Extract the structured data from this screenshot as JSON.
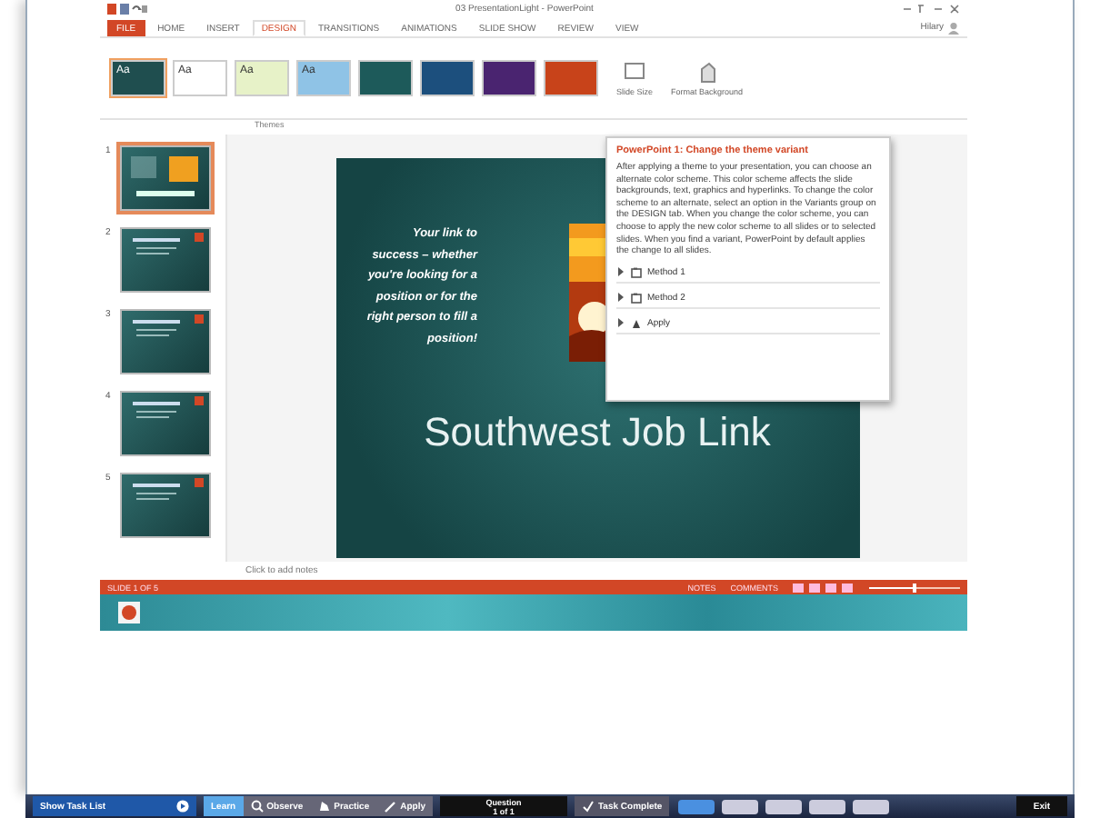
{
  "window": {
    "title": "03 PresentationLight - PowerPoint",
    "user": "Hilary"
  },
  "ribbon_tabs": [
    {
      "label": "FILE",
      "kind": "file",
      "selected": false
    },
    {
      "label": "HOME",
      "kind": "tab",
      "selected": false
    },
    {
      "label": "INSERT",
      "kind": "tab",
      "selected": false
    },
    {
      "label": "DESIGN",
      "kind": "tab",
      "selected": true
    },
    {
      "label": "TRANSITIONS",
      "kind": "tab",
      "selected": false
    },
    {
      "label": "ANIMATIONS",
      "kind": "tab",
      "selected": false
    },
    {
      "label": "SLIDE SHOW",
      "kind": "tab",
      "selected": false
    },
    {
      "label": "REVIEW",
      "kind": "tab",
      "selected": false
    },
    {
      "label": "VIEW",
      "kind": "tab",
      "selected": false
    }
  ],
  "themes": [
    {
      "label": "Aa",
      "color": "#1f4e4f",
      "selected": true
    },
    {
      "label": "Aa",
      "color": "#ffffff",
      "selected": false
    },
    {
      "label": "Aa",
      "color": "#e7f2c8",
      "selected": false
    },
    {
      "label": "Aa",
      "color": "#8fc3e6",
      "selected": false
    },
    {
      "color": "#1d5a5a",
      "selected": false
    },
    {
      "color": "#1c4f7d",
      "selected": false
    },
    {
      "color": "#4a2470",
      "selected": false
    },
    {
      "color": "#c8431a",
      "selected": false
    }
  ],
  "customize_buttons": [
    "Slide Size",
    "Format Background"
  ],
  "group_label": "Themes",
  "slides": [
    {
      "number": "1",
      "selected": true
    },
    {
      "number": "2",
      "selected": false
    },
    {
      "number": "3",
      "selected": false
    },
    {
      "number": "4",
      "selected": false
    },
    {
      "number": "5",
      "selected": false
    }
  ],
  "slide": {
    "tagline": "Your link to success – whether you're looking for a position or for the right person to fill a position!",
    "title": "Southwest Job Link"
  },
  "notes_placeholder": "Click to add notes",
  "status_bar": {
    "slide": "SLIDE 1 OF 5",
    "notes": "NOTES",
    "comments": "COMMENTS",
    "zoom": {
      "level": 0.5
    }
  },
  "help_panel": {
    "title": "PowerPoint 1: Change the theme variant",
    "body": "After applying a theme to your presentation, you can choose an alternate color scheme. This color scheme affects the slide backgrounds, text, graphics and hyperlinks. To change the color scheme to an alternate, select an option in the Variants group on the DESIGN tab. When you change the color scheme, you can choose to apply the new color scheme to all slides or to selected slides. When you find a variant, PowerPoint by default applies the change to all slides.",
    "items": [
      {
        "label": "Method 1",
        "expanded": false
      },
      {
        "label": "Method 2",
        "expanded": false
      },
      {
        "label": "Apply",
        "expanded": false
      }
    ]
  },
  "sim_bar": {
    "task_list": "Show Task List",
    "modes": [
      {
        "label": "Learn",
        "selected": true
      },
      {
        "label": "Observe",
        "selected": false
      },
      {
        "label": "Practice",
        "selected": false
      },
      {
        "label": "Apply",
        "selected": false
      }
    ],
    "question": "Question",
    "question_count": "1 of 1",
    "task_complete": "Task Complete",
    "exit": "Exit"
  }
}
